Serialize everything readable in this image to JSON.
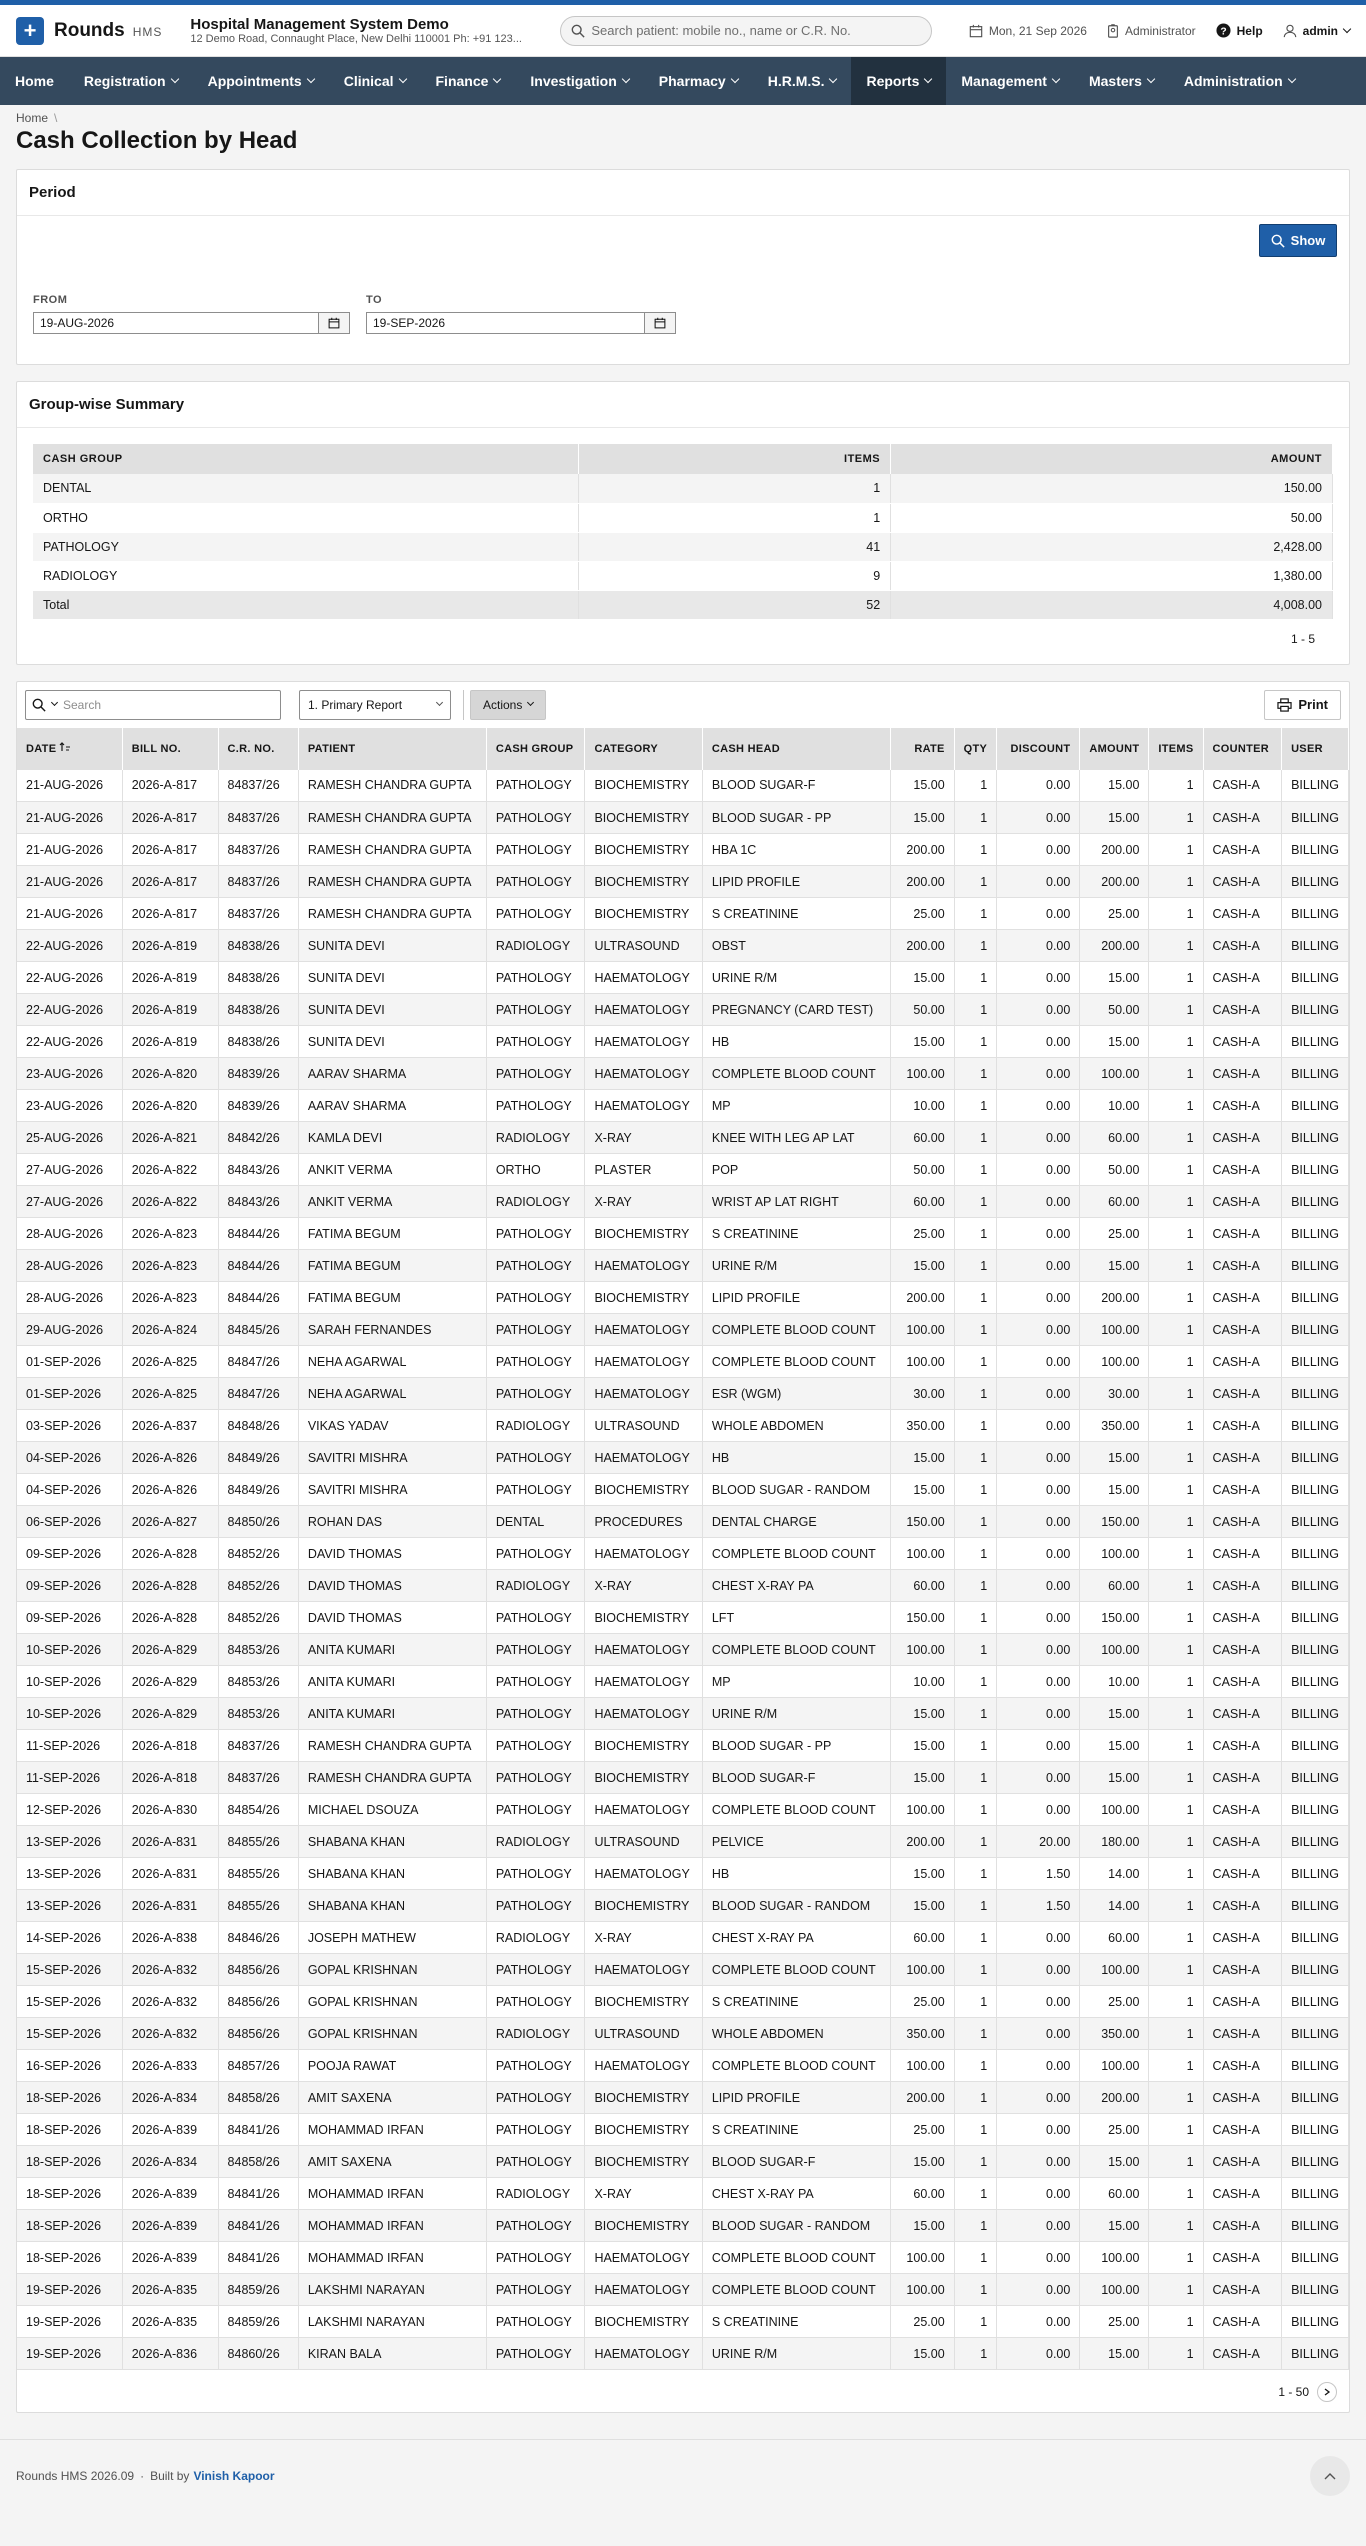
{
  "app": {
    "name": "Rounds",
    "sub": "HMS"
  },
  "hospital": {
    "name": "Hospital Management System Demo",
    "address": "12 Demo Road, Connaught Place, New Delhi 110001 Ph: +91 123..."
  },
  "search": {
    "placeholder": "Search patient: mobile no., name or C.R. No."
  },
  "topbar": {
    "date": "Mon, 21 Sep 2026",
    "role": "Administrator",
    "help": "Help",
    "user": "admin"
  },
  "nav": [
    {
      "label": "Home",
      "has_menu": false
    },
    {
      "label": "Registration",
      "has_menu": true
    },
    {
      "label": "Appointments",
      "has_menu": true
    },
    {
      "label": "Clinical",
      "has_menu": true
    },
    {
      "label": "Finance",
      "has_menu": true
    },
    {
      "label": "Investigation",
      "has_menu": true
    },
    {
      "label": "Pharmacy",
      "has_menu": true
    },
    {
      "label": "H.R.M.S.",
      "has_menu": true
    },
    {
      "label": "Reports",
      "has_menu": true,
      "active": true
    },
    {
      "label": "Management",
      "has_menu": true
    },
    {
      "label": "Masters",
      "has_menu": true
    },
    {
      "label": "Administration",
      "has_menu": true
    }
  ],
  "breadcrumb": {
    "home": "Home",
    "sep": "\\"
  },
  "page": {
    "title": "Cash Collection by Head"
  },
  "period": {
    "title": "Period",
    "show_label": "Show",
    "from_label": "FROM",
    "from_value": "19-AUG-2026",
    "to_label": "TO",
    "to_value": "19-SEP-2026"
  },
  "summary": {
    "title": "Group-wise Summary",
    "headers": [
      "CASH GROUP",
      "ITEMS",
      "AMOUNT"
    ],
    "rows": [
      [
        "DENTAL",
        "1",
        "150.00"
      ],
      [
        "ORTHO",
        "1",
        "50.00"
      ],
      [
        "PATHOLOGY",
        "41",
        "2,428.00"
      ],
      [
        "RADIOLOGY",
        "9",
        "1,380.00"
      ]
    ],
    "total": [
      "Total",
      "52",
      "4,008.00"
    ],
    "pager": "1 - 5"
  },
  "report": {
    "search_placeholder": "Search",
    "report_select": "1. Primary Report",
    "actions_label": "Actions",
    "print_label": "Print",
    "headers": [
      "DATE",
      "BILL NO.",
      "C.R. NO.",
      "PATIENT",
      "CASH GROUP",
      "CATEGORY",
      "CASH HEAD",
      "RATE",
      "QTY",
      "DISCOUNT",
      "AMOUNT",
      "ITEMS",
      "COUNTER",
      "USER"
    ],
    "rows": [
      [
        "21-AUG-2026",
        "2026-A-817",
        "84837/26",
        "RAMESH CHANDRA GUPTA",
        "PATHOLOGY",
        "BIOCHEMISTRY",
        "BLOOD SUGAR-F",
        "15.00",
        "1",
        "0.00",
        "15.00",
        "1",
        "CASH-A",
        "BILLING"
      ],
      [
        "21-AUG-2026",
        "2026-A-817",
        "84837/26",
        "RAMESH CHANDRA GUPTA",
        "PATHOLOGY",
        "BIOCHEMISTRY",
        "BLOOD SUGAR - PP",
        "15.00",
        "1",
        "0.00",
        "15.00",
        "1",
        "CASH-A",
        "BILLING"
      ],
      [
        "21-AUG-2026",
        "2026-A-817",
        "84837/26",
        "RAMESH CHANDRA GUPTA",
        "PATHOLOGY",
        "BIOCHEMISTRY",
        "HBA 1C",
        "200.00",
        "1",
        "0.00",
        "200.00",
        "1",
        "CASH-A",
        "BILLING"
      ],
      [
        "21-AUG-2026",
        "2026-A-817",
        "84837/26",
        "RAMESH CHANDRA GUPTA",
        "PATHOLOGY",
        "BIOCHEMISTRY",
        "LIPID PROFILE",
        "200.00",
        "1",
        "0.00",
        "200.00",
        "1",
        "CASH-A",
        "BILLING"
      ],
      [
        "21-AUG-2026",
        "2026-A-817",
        "84837/26",
        "RAMESH CHANDRA GUPTA",
        "PATHOLOGY",
        "BIOCHEMISTRY",
        "S CREATININE",
        "25.00",
        "1",
        "0.00",
        "25.00",
        "1",
        "CASH-A",
        "BILLING"
      ],
      [
        "22-AUG-2026",
        "2026-A-819",
        "84838/26",
        "SUNITA DEVI",
        "RADIOLOGY",
        "ULTRASOUND",
        "OBST",
        "200.00",
        "1",
        "0.00",
        "200.00",
        "1",
        "CASH-A",
        "BILLING"
      ],
      [
        "22-AUG-2026",
        "2026-A-819",
        "84838/26",
        "SUNITA DEVI",
        "PATHOLOGY",
        "HAEMATOLOGY",
        "URINE R/M",
        "15.00",
        "1",
        "0.00",
        "15.00",
        "1",
        "CASH-A",
        "BILLING"
      ],
      [
        "22-AUG-2026",
        "2026-A-819",
        "84838/26",
        "SUNITA DEVI",
        "PATHOLOGY",
        "HAEMATOLOGY",
        "PREGNANCY (CARD TEST)",
        "50.00",
        "1",
        "0.00",
        "50.00",
        "1",
        "CASH-A",
        "BILLING"
      ],
      [
        "22-AUG-2026",
        "2026-A-819",
        "84838/26",
        "SUNITA DEVI",
        "PATHOLOGY",
        "HAEMATOLOGY",
        "HB",
        "15.00",
        "1",
        "0.00",
        "15.00",
        "1",
        "CASH-A",
        "BILLING"
      ],
      [
        "23-AUG-2026",
        "2026-A-820",
        "84839/26",
        "AARAV SHARMA",
        "PATHOLOGY",
        "HAEMATOLOGY",
        "COMPLETE BLOOD COUNT",
        "100.00",
        "1",
        "0.00",
        "100.00",
        "1",
        "CASH-A",
        "BILLING"
      ],
      [
        "23-AUG-2026",
        "2026-A-820",
        "84839/26",
        "AARAV SHARMA",
        "PATHOLOGY",
        "HAEMATOLOGY",
        "MP",
        "10.00",
        "1",
        "0.00",
        "10.00",
        "1",
        "CASH-A",
        "BILLING"
      ],
      [
        "25-AUG-2026",
        "2026-A-821",
        "84842/26",
        "KAMLA DEVI",
        "RADIOLOGY",
        "X-RAY",
        "KNEE WITH LEG AP LAT",
        "60.00",
        "1",
        "0.00",
        "60.00",
        "1",
        "CASH-A",
        "BILLING"
      ],
      [
        "27-AUG-2026",
        "2026-A-822",
        "84843/26",
        "ANKIT VERMA",
        "ORTHO",
        "PLASTER",
        "POP",
        "50.00",
        "1",
        "0.00",
        "50.00",
        "1",
        "CASH-A",
        "BILLING"
      ],
      [
        "27-AUG-2026",
        "2026-A-822",
        "84843/26",
        "ANKIT VERMA",
        "RADIOLOGY",
        "X-RAY",
        "WRIST AP LAT RIGHT",
        "60.00",
        "1",
        "0.00",
        "60.00",
        "1",
        "CASH-A",
        "BILLING"
      ],
      [
        "28-AUG-2026",
        "2026-A-823",
        "84844/26",
        "FATIMA BEGUM",
        "PATHOLOGY",
        "BIOCHEMISTRY",
        "S CREATININE",
        "25.00",
        "1",
        "0.00",
        "25.00",
        "1",
        "CASH-A",
        "BILLING"
      ],
      [
        "28-AUG-2026",
        "2026-A-823",
        "84844/26",
        "FATIMA BEGUM",
        "PATHOLOGY",
        "HAEMATOLOGY",
        "URINE R/M",
        "15.00",
        "1",
        "0.00",
        "15.00",
        "1",
        "CASH-A",
        "BILLING"
      ],
      [
        "28-AUG-2026",
        "2026-A-823",
        "84844/26",
        "FATIMA BEGUM",
        "PATHOLOGY",
        "BIOCHEMISTRY",
        "LIPID PROFILE",
        "200.00",
        "1",
        "0.00",
        "200.00",
        "1",
        "CASH-A",
        "BILLING"
      ],
      [
        "29-AUG-2026",
        "2026-A-824",
        "84845/26",
        "SARAH FERNANDES",
        "PATHOLOGY",
        "HAEMATOLOGY",
        "COMPLETE BLOOD COUNT",
        "100.00",
        "1",
        "0.00",
        "100.00",
        "1",
        "CASH-A",
        "BILLING"
      ],
      [
        "01-SEP-2026",
        "2026-A-825",
        "84847/26",
        "NEHA AGARWAL",
        "PATHOLOGY",
        "HAEMATOLOGY",
        "COMPLETE BLOOD COUNT",
        "100.00",
        "1",
        "0.00",
        "100.00",
        "1",
        "CASH-A",
        "BILLING"
      ],
      [
        "01-SEP-2026",
        "2026-A-825",
        "84847/26",
        "NEHA AGARWAL",
        "PATHOLOGY",
        "HAEMATOLOGY",
        "ESR (WGM)",
        "30.00",
        "1",
        "0.00",
        "30.00",
        "1",
        "CASH-A",
        "BILLING"
      ],
      [
        "03-SEP-2026",
        "2026-A-837",
        "84848/26",
        "VIKAS YADAV",
        "RADIOLOGY",
        "ULTRASOUND",
        "WHOLE ABDOMEN",
        "350.00",
        "1",
        "0.00",
        "350.00",
        "1",
        "CASH-A",
        "BILLING"
      ],
      [
        "04-SEP-2026",
        "2026-A-826",
        "84849/26",
        "SAVITRI MISHRA",
        "PATHOLOGY",
        "HAEMATOLOGY",
        "HB",
        "15.00",
        "1",
        "0.00",
        "15.00",
        "1",
        "CASH-A",
        "BILLING"
      ],
      [
        "04-SEP-2026",
        "2026-A-826",
        "84849/26",
        "SAVITRI MISHRA",
        "PATHOLOGY",
        "BIOCHEMISTRY",
        "BLOOD SUGAR - RANDOM",
        "15.00",
        "1",
        "0.00",
        "15.00",
        "1",
        "CASH-A",
        "BILLING"
      ],
      [
        "06-SEP-2026",
        "2026-A-827",
        "84850/26",
        "ROHAN DAS",
        "DENTAL",
        "PROCEDURES",
        "DENTAL CHARGE",
        "150.00",
        "1",
        "0.00",
        "150.00",
        "1",
        "CASH-A",
        "BILLING"
      ],
      [
        "09-SEP-2026",
        "2026-A-828",
        "84852/26",
        "DAVID THOMAS",
        "PATHOLOGY",
        "HAEMATOLOGY",
        "COMPLETE BLOOD COUNT",
        "100.00",
        "1",
        "0.00",
        "100.00",
        "1",
        "CASH-A",
        "BILLING"
      ],
      [
        "09-SEP-2026",
        "2026-A-828",
        "84852/26",
        "DAVID THOMAS",
        "RADIOLOGY",
        "X-RAY",
        "CHEST X-RAY PA",
        "60.00",
        "1",
        "0.00",
        "60.00",
        "1",
        "CASH-A",
        "BILLING"
      ],
      [
        "09-SEP-2026",
        "2026-A-828",
        "84852/26",
        "DAVID THOMAS",
        "PATHOLOGY",
        "BIOCHEMISTRY",
        "LFT",
        "150.00",
        "1",
        "0.00",
        "150.00",
        "1",
        "CASH-A",
        "BILLING"
      ],
      [
        "10-SEP-2026",
        "2026-A-829",
        "84853/26",
        "ANITA KUMARI",
        "PATHOLOGY",
        "HAEMATOLOGY",
        "COMPLETE BLOOD COUNT",
        "100.00",
        "1",
        "0.00",
        "100.00",
        "1",
        "CASH-A",
        "BILLING"
      ],
      [
        "10-SEP-2026",
        "2026-A-829",
        "84853/26",
        "ANITA KUMARI",
        "PATHOLOGY",
        "HAEMATOLOGY",
        "MP",
        "10.00",
        "1",
        "0.00",
        "10.00",
        "1",
        "CASH-A",
        "BILLING"
      ],
      [
        "10-SEP-2026",
        "2026-A-829",
        "84853/26",
        "ANITA KUMARI",
        "PATHOLOGY",
        "HAEMATOLOGY",
        "URINE R/M",
        "15.00",
        "1",
        "0.00",
        "15.00",
        "1",
        "CASH-A",
        "BILLING"
      ],
      [
        "11-SEP-2026",
        "2026-A-818",
        "84837/26",
        "RAMESH CHANDRA GUPTA",
        "PATHOLOGY",
        "BIOCHEMISTRY",
        "BLOOD SUGAR - PP",
        "15.00",
        "1",
        "0.00",
        "15.00",
        "1",
        "CASH-A",
        "BILLING"
      ],
      [
        "11-SEP-2026",
        "2026-A-818",
        "84837/26",
        "RAMESH CHANDRA GUPTA",
        "PATHOLOGY",
        "BIOCHEMISTRY",
        "BLOOD SUGAR-F",
        "15.00",
        "1",
        "0.00",
        "15.00",
        "1",
        "CASH-A",
        "BILLING"
      ],
      [
        "12-SEP-2026",
        "2026-A-830",
        "84854/26",
        "MICHAEL DSOUZA",
        "PATHOLOGY",
        "HAEMATOLOGY",
        "COMPLETE BLOOD COUNT",
        "100.00",
        "1",
        "0.00",
        "100.00",
        "1",
        "CASH-A",
        "BILLING"
      ],
      [
        "13-SEP-2026",
        "2026-A-831",
        "84855/26",
        "SHABANA KHAN",
        "RADIOLOGY",
        "ULTRASOUND",
        "PELVICE",
        "200.00",
        "1",
        "20.00",
        "180.00",
        "1",
        "CASH-A",
        "BILLING"
      ],
      [
        "13-SEP-2026",
        "2026-A-831",
        "84855/26",
        "SHABANA KHAN",
        "PATHOLOGY",
        "HAEMATOLOGY",
        "HB",
        "15.00",
        "1",
        "1.50",
        "14.00",
        "1",
        "CASH-A",
        "BILLING"
      ],
      [
        "13-SEP-2026",
        "2026-A-831",
        "84855/26",
        "SHABANA KHAN",
        "PATHOLOGY",
        "BIOCHEMISTRY",
        "BLOOD SUGAR - RANDOM",
        "15.00",
        "1",
        "1.50",
        "14.00",
        "1",
        "CASH-A",
        "BILLING"
      ],
      [
        "14-SEP-2026",
        "2026-A-838",
        "84846/26",
        "JOSEPH MATHEW",
        "RADIOLOGY",
        "X-RAY",
        "CHEST X-RAY PA",
        "60.00",
        "1",
        "0.00",
        "60.00",
        "1",
        "CASH-A",
        "BILLING"
      ],
      [
        "15-SEP-2026",
        "2026-A-832",
        "84856/26",
        "GOPAL KRISHNAN",
        "PATHOLOGY",
        "HAEMATOLOGY",
        "COMPLETE BLOOD COUNT",
        "100.00",
        "1",
        "0.00",
        "100.00",
        "1",
        "CASH-A",
        "BILLING"
      ],
      [
        "15-SEP-2026",
        "2026-A-832",
        "84856/26",
        "GOPAL KRISHNAN",
        "PATHOLOGY",
        "BIOCHEMISTRY",
        "S CREATININE",
        "25.00",
        "1",
        "0.00",
        "25.00",
        "1",
        "CASH-A",
        "BILLING"
      ],
      [
        "15-SEP-2026",
        "2026-A-832",
        "84856/26",
        "GOPAL KRISHNAN",
        "RADIOLOGY",
        "ULTRASOUND",
        "WHOLE ABDOMEN",
        "350.00",
        "1",
        "0.00",
        "350.00",
        "1",
        "CASH-A",
        "BILLING"
      ],
      [
        "16-SEP-2026",
        "2026-A-833",
        "84857/26",
        "POOJA RAWAT",
        "PATHOLOGY",
        "HAEMATOLOGY",
        "COMPLETE BLOOD COUNT",
        "100.00",
        "1",
        "0.00",
        "100.00",
        "1",
        "CASH-A",
        "BILLING"
      ],
      [
        "18-SEP-2026",
        "2026-A-834",
        "84858/26",
        "AMIT SAXENA",
        "PATHOLOGY",
        "BIOCHEMISTRY",
        "LIPID PROFILE",
        "200.00",
        "1",
        "0.00",
        "200.00",
        "1",
        "CASH-A",
        "BILLING"
      ],
      [
        "18-SEP-2026",
        "2026-A-839",
        "84841/26",
        "MOHAMMAD IRFAN",
        "PATHOLOGY",
        "BIOCHEMISTRY",
        "S CREATININE",
        "25.00",
        "1",
        "0.00",
        "25.00",
        "1",
        "CASH-A",
        "BILLING"
      ],
      [
        "18-SEP-2026",
        "2026-A-834",
        "84858/26",
        "AMIT SAXENA",
        "PATHOLOGY",
        "BIOCHEMISTRY",
        "BLOOD SUGAR-F",
        "15.00",
        "1",
        "0.00",
        "15.00",
        "1",
        "CASH-A",
        "BILLING"
      ],
      [
        "18-SEP-2026",
        "2026-A-839",
        "84841/26",
        "MOHAMMAD IRFAN",
        "RADIOLOGY",
        "X-RAY",
        "CHEST X-RAY PA",
        "60.00",
        "1",
        "0.00",
        "60.00",
        "1",
        "CASH-A",
        "BILLING"
      ],
      [
        "18-SEP-2026",
        "2026-A-839",
        "84841/26",
        "MOHAMMAD IRFAN",
        "PATHOLOGY",
        "BIOCHEMISTRY",
        "BLOOD SUGAR - RANDOM",
        "15.00",
        "1",
        "0.00",
        "15.00",
        "1",
        "CASH-A",
        "BILLING"
      ],
      [
        "18-SEP-2026",
        "2026-A-839",
        "84841/26",
        "MOHAMMAD IRFAN",
        "PATHOLOGY",
        "HAEMATOLOGY",
        "COMPLETE BLOOD COUNT",
        "100.00",
        "1",
        "0.00",
        "100.00",
        "1",
        "CASH-A",
        "BILLING"
      ],
      [
        "19-SEP-2026",
        "2026-A-835",
        "84859/26",
        "LAKSHMI NARAYAN",
        "PATHOLOGY",
        "HAEMATOLOGY",
        "COMPLETE BLOOD COUNT",
        "100.00",
        "1",
        "0.00",
        "100.00",
        "1",
        "CASH-A",
        "BILLING"
      ],
      [
        "19-SEP-2026",
        "2026-A-835",
        "84859/26",
        "LAKSHMI NARAYAN",
        "PATHOLOGY",
        "BIOCHEMISTRY",
        "S CREATININE",
        "25.00",
        "1",
        "0.00",
        "25.00",
        "1",
        "CASH-A",
        "BILLING"
      ],
      [
        "19-SEP-2026",
        "2026-A-836",
        "84860/26",
        "KIRAN BALA",
        "PATHOLOGY",
        "HAEMATOLOGY",
        "URINE R/M",
        "15.00",
        "1",
        "0.00",
        "15.00",
        "1",
        "CASH-A",
        "BILLING"
      ]
    ],
    "pager": "1 - 50"
  },
  "footer": {
    "version": "Rounds HMS 2026.09",
    "dot": "·",
    "built_by": "Built by",
    "author": "Vinish Kapoor"
  },
  "colors": {
    "accent": "#1f5fa8",
    "nav_bg": "#34495e",
    "nav_active": "#22313f"
  }
}
